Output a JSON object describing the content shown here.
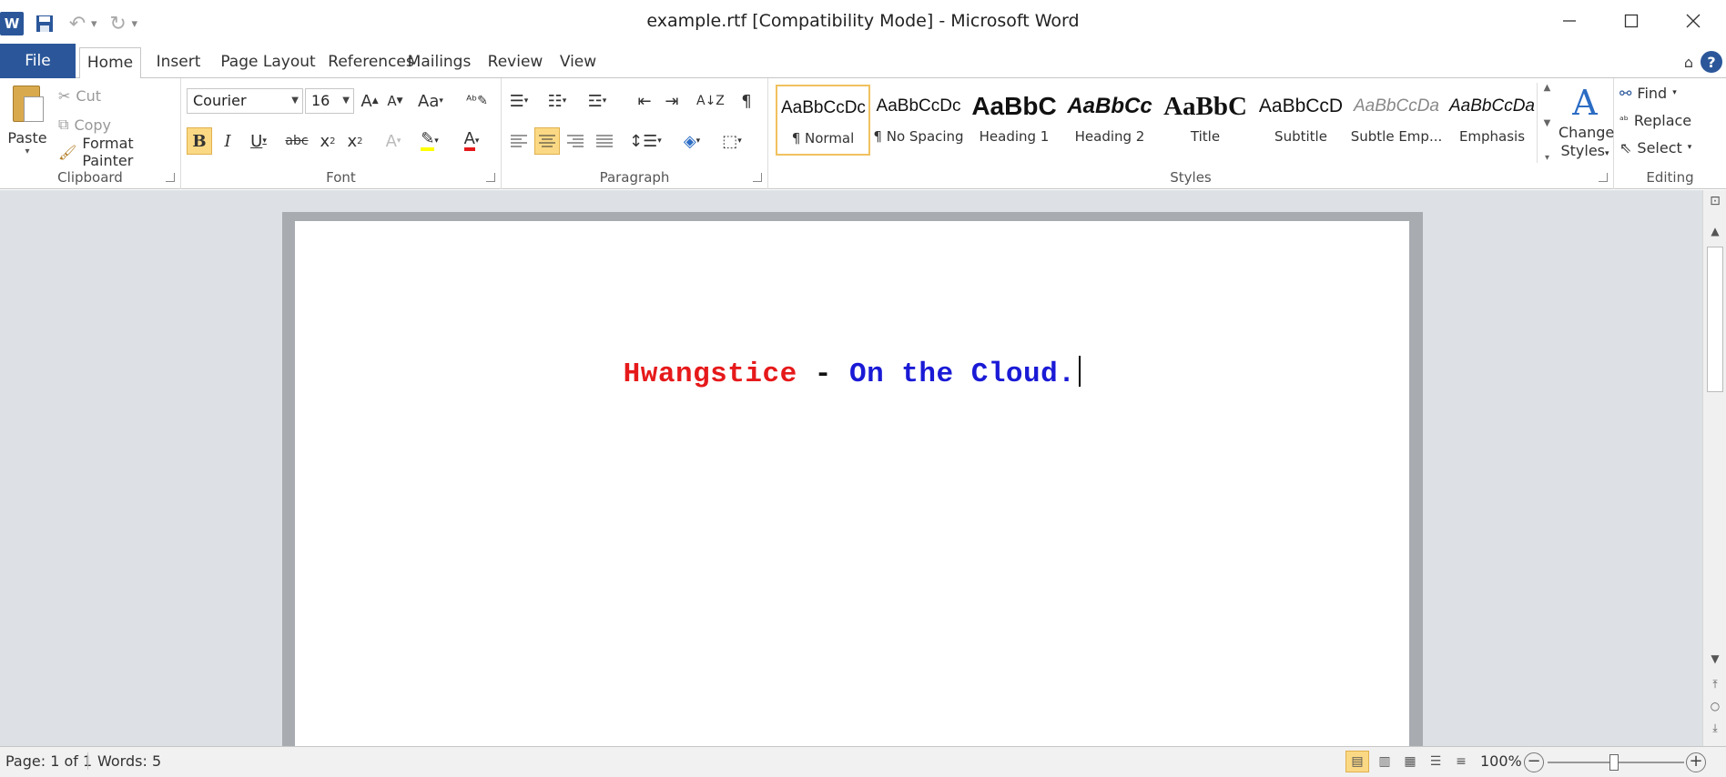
{
  "window": {
    "title": "example.rtf [Compatibility Mode] - Microsoft Word",
    "app_icon_letter": "W"
  },
  "tabs": [
    {
      "label": "File"
    },
    {
      "label": "Home"
    },
    {
      "label": "Insert"
    },
    {
      "label": "Page Layout"
    },
    {
      "label": "References"
    },
    {
      "label": "Mailings"
    },
    {
      "label": "Review"
    },
    {
      "label": "View"
    }
  ],
  "active_tab": "Home",
  "clipboard": {
    "group_label": "Clipboard",
    "paste_label": "Paste",
    "cut_label": "Cut",
    "copy_label": "Copy",
    "format_painter_label": "Format Painter"
  },
  "font": {
    "group_label": "Font",
    "font_name": "Courier",
    "font_size": "16",
    "bold": true,
    "highlight_color": "#ffff00",
    "font_color": "#e6191a"
  },
  "paragraph": {
    "group_label": "Paragraph",
    "alignment": "center"
  },
  "styles": {
    "group_label": "Styles",
    "items": [
      {
        "sample": "AaBbCcDc",
        "name": "¶ Normal",
        "selected": true
      },
      {
        "sample": "AaBbCcDc",
        "name": "¶ No Spacing",
        "selected": false
      },
      {
        "sample": "AaBbC",
        "name": "Heading 1",
        "selected": false
      },
      {
        "sample": "AaBbCc",
        "name": "Heading 2",
        "selected": false
      },
      {
        "sample": "AaBbC",
        "name": "Title",
        "selected": false
      },
      {
        "sample": "AaBbCcD",
        "name": "Subtitle",
        "selected": false
      },
      {
        "sample": "AaBbCcDa",
        "name": "Subtle Emp...",
        "selected": false
      },
      {
        "sample": "AaBbCcDa",
        "name": "Emphasis",
        "selected": false
      }
    ],
    "change_styles_line1": "Change",
    "change_styles_line2": "Styles"
  },
  "editing": {
    "group_label": "Editing",
    "find_label": "Find",
    "replace_label": "Replace",
    "select_label": "Select"
  },
  "document": {
    "runs": [
      {
        "text": "Hwangstice",
        "color": "#e6191a"
      },
      {
        "text": " - ",
        "color": "#111111"
      },
      {
        "text": "On the Cloud.",
        "color": "#1a1ad6"
      }
    ]
  },
  "status": {
    "page": "Page: 1 of 1",
    "words": "Words: 5",
    "zoom": "100%"
  }
}
